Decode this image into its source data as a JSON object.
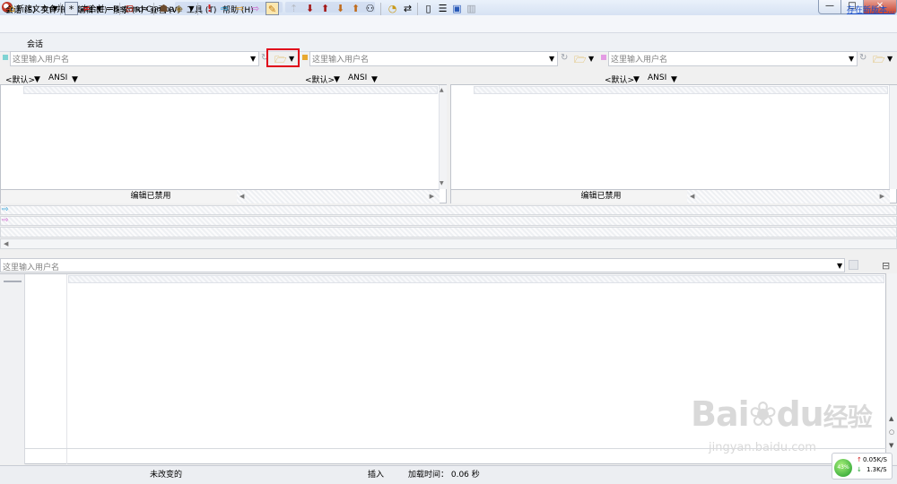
{
  "window": {
    "title": "新建文本合并 - 文本合并 - Beyond Compare",
    "min_glyph": "—",
    "max_glyph": "□",
    "close_glyph": "✕"
  },
  "menu": {
    "items": [
      "会话 (S)",
      "文件 (F)",
      "编辑 (E)",
      "搜索 (R)",
      "查看 (V)",
      "工具 (T)",
      "帮助 (H)"
    ],
    "update_link": "存在新版本..."
  },
  "toolbar": {
    "session_label": "会话"
  },
  "files": {
    "left_placeholder": "这里输入用户名",
    "center_placeholder": "这里输入用户名",
    "right_placeholder": "这里输入用户名",
    "output_placeholder": "这里输入用户名"
  },
  "encoding": {
    "default_label": "<默认>",
    "charset": "ANSI"
  },
  "panes": {
    "left_status": "编辑已禁用",
    "right_status": "编辑已禁用"
  },
  "statusbar": {
    "state": "未改变的",
    "mode": "插入",
    "load_time": "加载时间： 0.06 秒"
  },
  "network": {
    "percent": "43%",
    "up": "0.05K/S",
    "down": "1.3K/S"
  },
  "watermark": {
    "brand": "Bai",
    "brand2": "du",
    "brand_cn": "经验",
    "url": "jingyan.baidu.com"
  },
  "colors": {
    "left_marker": "#7fd3d3",
    "center_marker": "#e8a830",
    "right_marker": "#e49be4",
    "highlight": "#e0001a"
  }
}
